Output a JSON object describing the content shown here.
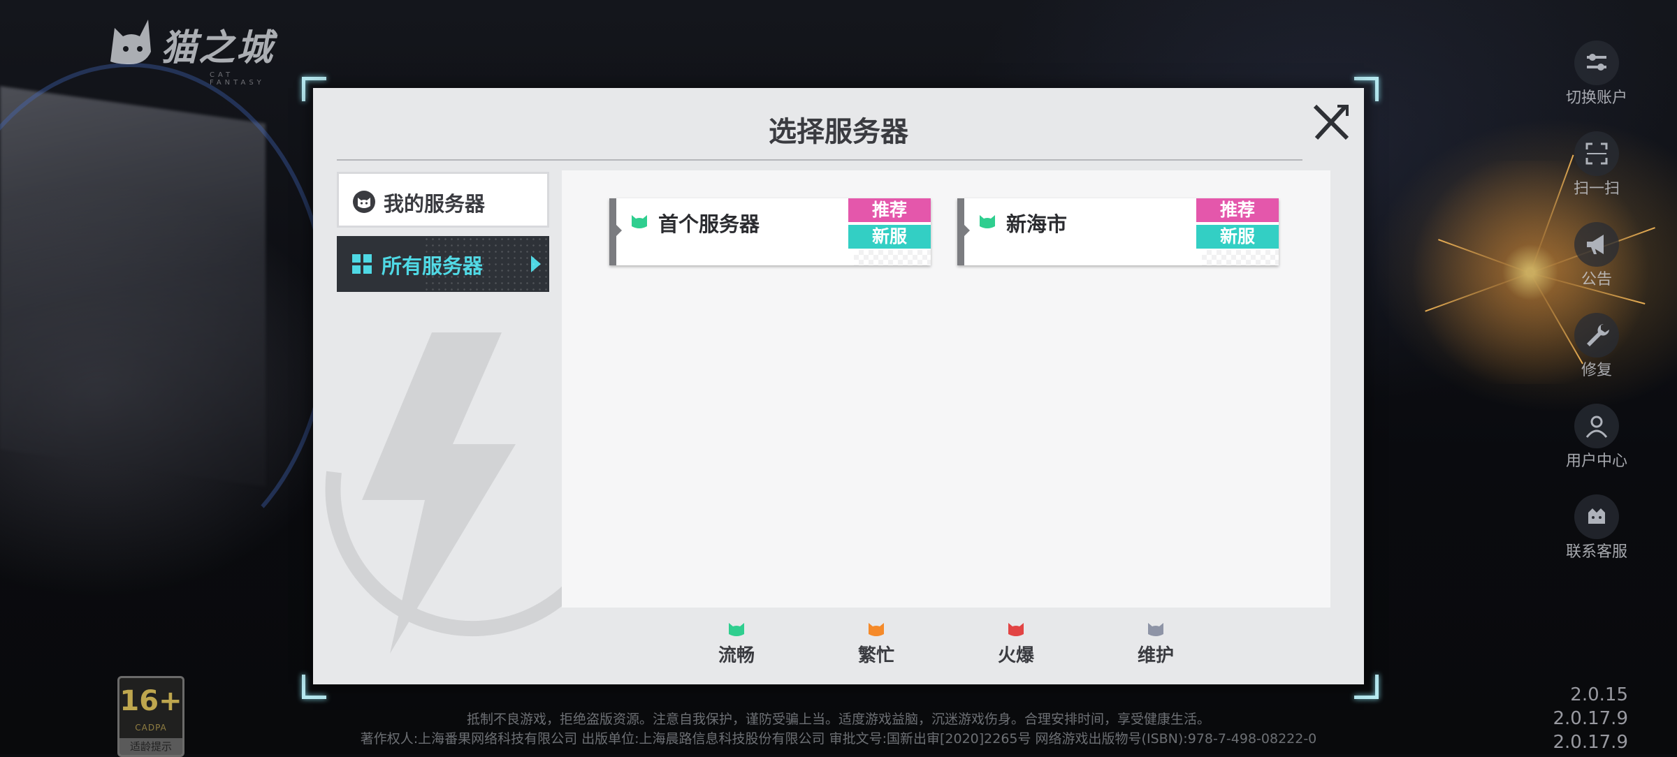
{
  "logo": {
    "text": "猫之城",
    "subtext": "CAT FANTASY"
  },
  "modal": {
    "title": "选择服务器",
    "tabs": [
      {
        "label": "我的服务器",
        "selected": false
      },
      {
        "label": "所有服务器",
        "selected": true
      }
    ],
    "servers": [
      {
        "name": "首个服务器",
        "status": "流畅",
        "badges": [
          "推荐",
          "新服"
        ]
      },
      {
        "name": "新海市",
        "status": "流畅",
        "badges": [
          "推荐",
          "新服"
        ]
      }
    ],
    "legend": [
      {
        "label": "流畅",
        "color": "#2fce8f"
      },
      {
        "label": "繁忙",
        "color": "#f58a2a"
      },
      {
        "label": "火爆",
        "color": "#e24444"
      },
      {
        "label": "维护",
        "color": "#8e94a6"
      }
    ]
  },
  "side_menu": [
    {
      "label": "切换账户",
      "icon": "switch-account-icon"
    },
    {
      "label": "扫一扫",
      "icon": "scan-icon"
    },
    {
      "label": "公告",
      "icon": "megaphone-icon"
    },
    {
      "label": "修复",
      "icon": "wrench-icon"
    },
    {
      "label": "用户中心",
      "icon": "user-icon"
    },
    {
      "label": "联系客服",
      "icon": "customer-service-icon"
    }
  ],
  "age_rating": {
    "number": "16+",
    "org": "CADPA",
    "tip": "适龄提示"
  },
  "footer": {
    "line1": "抵制不良游戏，拒绝盗版资源。注意自我保护，谨防受骗上当。适度游戏益脑，沉迷游戏伤身。合理安排时间，享受健康生活。",
    "line2": "著作权人:上海番果网络科技有限公司 出版单位:上海晨路信息科技股份有限公司 审批文号:国新出审[2020]2265号 网络游戏出版物号(ISBN):978-7-498-08222-0"
  },
  "versions": [
    "2.0.15",
    "2.0.17.9",
    "2.0.17.9"
  ],
  "colors": {
    "accent_cyan": "#4fd8e4",
    "badge_pink": "#e457ab",
    "badge_teal": "#33cfc4"
  }
}
